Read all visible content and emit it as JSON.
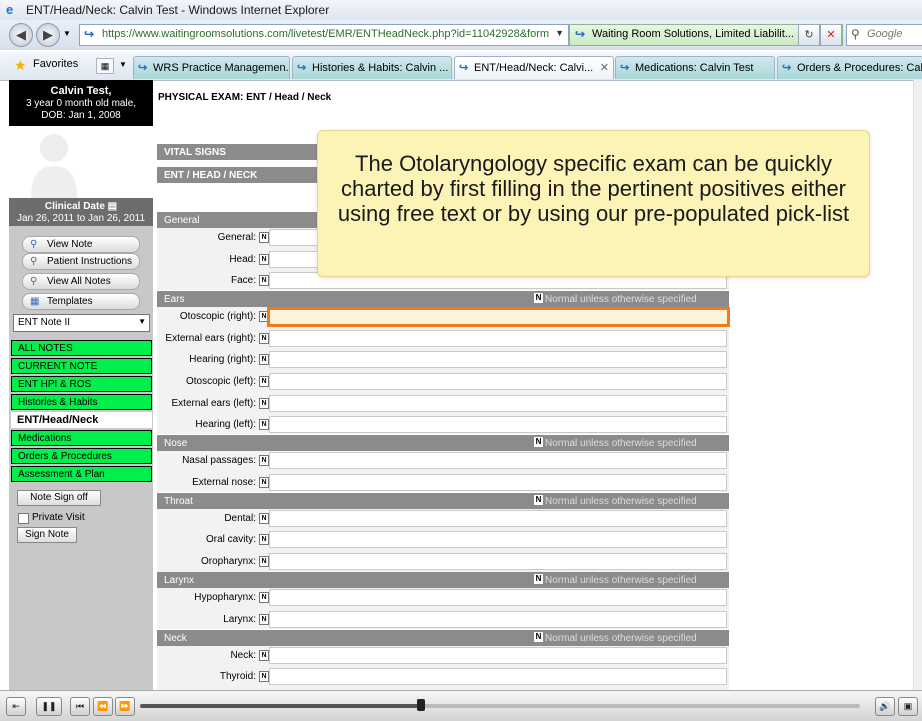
{
  "window": {
    "title": "ENT/Head/Neck: Calvin Test - Windows Internet Explorer"
  },
  "addressbar": {
    "url": "https://www.waitingroomsolutions.com/livetest/EMR/ENTHeadNeck.php?id=11042928&form",
    "site_identity": "Waiting Room Solutions, Limited Liabilit...",
    "search_placeholder": "Google"
  },
  "favorites": {
    "label": "Favorites"
  },
  "tabs": [
    {
      "label": "WRS Practice Managemen..."
    },
    {
      "label": "Histories & Habits: Calvin ..."
    },
    {
      "label": "ENT/Head/Neck: Calvi...",
      "active": true
    },
    {
      "label": "Medications: Calvin Test"
    },
    {
      "label": "Orders & Procedures: Calvi"
    }
  ],
  "patient": {
    "name": "Calvin Test,",
    "age": "3 year 0 month old male,",
    "dob": "DOB: Jan 1, 2008"
  },
  "clinical_date": {
    "label": "Clinical Date",
    "range": "Jan 26, 2011 to Jan 26, 2011"
  },
  "actions": [
    {
      "label": "View Note"
    },
    {
      "label": "Patient Instructions"
    },
    {
      "label": "View All Notes"
    },
    {
      "label": "Templates"
    }
  ],
  "note_select": {
    "value": "ENT Note II"
  },
  "nav": [
    {
      "label": "ALL NOTES"
    },
    {
      "label": "CURRENT NOTE"
    },
    {
      "label": "ENT HPI & ROS"
    },
    {
      "label": "Histories & Habits"
    },
    {
      "label": "ENT/Head/Neck",
      "active": true
    },
    {
      "label": "Medications"
    },
    {
      "label": "Orders & Procedures"
    },
    {
      "label": "Assessment & Plan"
    }
  ],
  "sidebar_buttons": {
    "sign_off": "Note Sign off",
    "private_visit": "Private Visit",
    "sign_note": "Sign Note"
  },
  "page": {
    "title": "PHYSICAL EXAM: ENT / Head / Neck"
  },
  "top_sections": {
    "vitals": "VITAL SIGNS",
    "ent": "ENT / HEAD / NECK"
  },
  "n_mark": "N",
  "normal_text": "Normal unless otherwise specified",
  "sections": {
    "general": {
      "title": "General",
      "rows": [
        "General:",
        "Head:",
        "Face:"
      ]
    },
    "ears": {
      "title": "Ears",
      "rows": [
        "Otoscopic (right):",
        "External ears (right):",
        "Hearing (right):",
        "Otoscopic (left):",
        "External ears (left):",
        "Hearing (left):"
      ]
    },
    "nose": {
      "title": "Nose",
      "rows": [
        "Nasal passages:",
        "External nose:"
      ]
    },
    "throat": {
      "title": "Throat",
      "rows": [
        "Dental:",
        "Oral cavity:",
        "Oropharynx:"
      ]
    },
    "larynx": {
      "title": "Larynx",
      "rows": [
        "Hypopharynx:",
        "Larynx:"
      ]
    },
    "neck": {
      "title": "Neck",
      "rows": [
        "Neck:",
        "Thyroid:"
      ]
    }
  },
  "callout": {
    "text": "The Otolaryngology specific exam can be quickly charted by first filling in the pertinent positives either using free text or by using our pre-populated pick-list"
  },
  "player": {
    "progress": 0.39
  }
}
